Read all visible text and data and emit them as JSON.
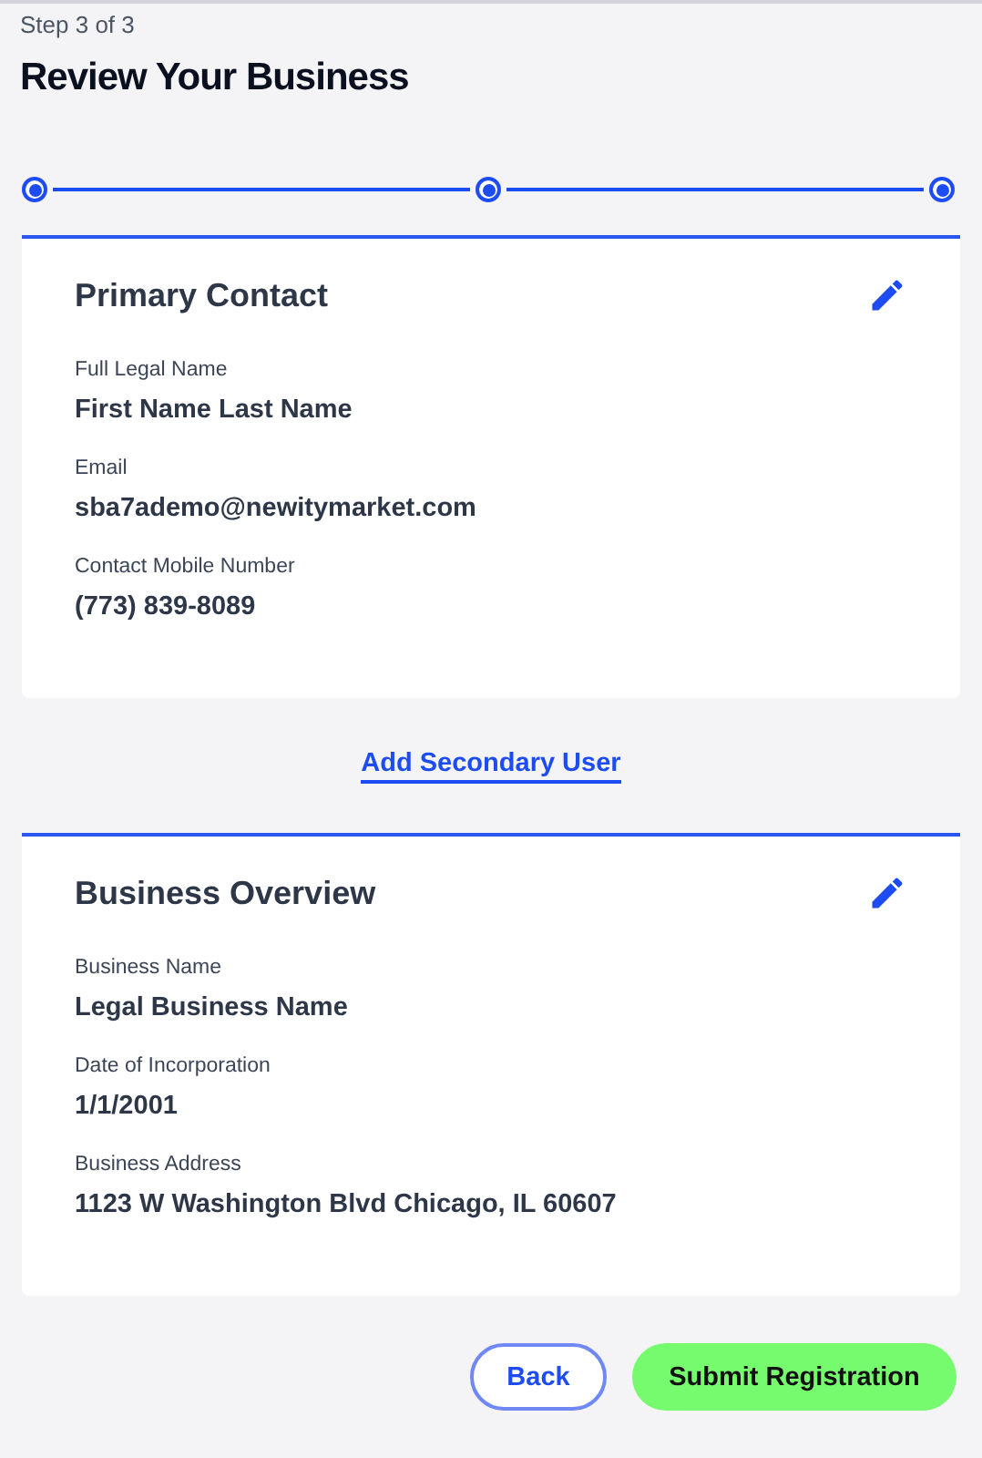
{
  "header": {
    "step": "Step 3 of 3",
    "title": "Review Your Business"
  },
  "stepper": [
    {
      "completed": true
    },
    {
      "completed": true
    },
    {
      "completed": true
    }
  ],
  "sections": [
    {
      "title": "Primary Contact",
      "fields": [
        {
          "label": "Full Legal Name",
          "value": "First Name Last Name"
        },
        {
          "label": "Email",
          "value": "sba7ademo@newitymarket.com"
        },
        {
          "label": "Contact Mobile Number",
          "value": "(773) 839-8089"
        }
      ]
    },
    {
      "title": "Business Overview",
      "fields": [
        {
          "label": "Business Name",
          "value": "Legal Business Name"
        },
        {
          "label": "Date of Incorporation",
          "value": "1/1/2001"
        },
        {
          "label": "Business Address",
          "value": "1123 W Washington Blvd Chicago, IL 60607"
        }
      ]
    }
  ],
  "add_secondary_link": "Add Secondary User",
  "buttons": {
    "back": "Back",
    "submit": "Submit Registration"
  }
}
